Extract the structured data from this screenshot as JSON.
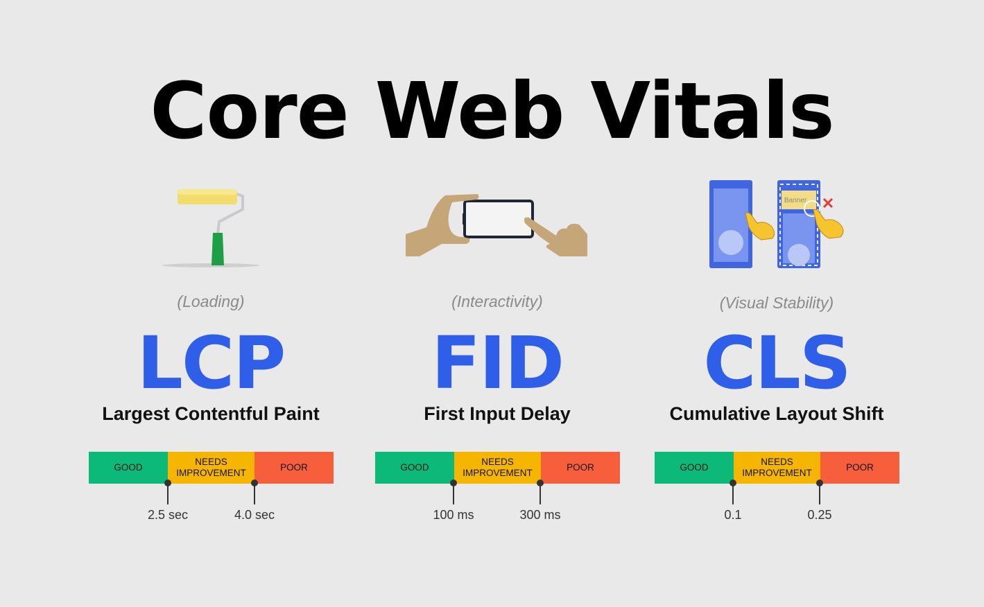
{
  "title": "Core Web Vitals",
  "colors": {
    "background": "#e9e9e9",
    "acronym": "#2f5fe8",
    "good": "#0cb978",
    "needs_improvement": "#f6b500",
    "poor": "#f75e3c"
  },
  "metrics": [
    {
      "category": "(Loading)",
      "acronym": "LCP",
      "full_name": "Largest Contentful Paint",
      "illustration": "paint-roller-icon",
      "bands": [
        "GOOD",
        "NEEDS IMPROVEMENT",
        "POOR"
      ],
      "thresholds": [
        "2.5 sec",
        "4.0 sec"
      ]
    },
    {
      "category": "(Interactivity)",
      "acronym": "FID",
      "full_name": "First Input Delay",
      "illustration": "hand-tapping-phone-icon",
      "bands": [
        "GOOD",
        "NEEDS IMPROVEMENT",
        "POOR"
      ],
      "thresholds": [
        "100 ms",
        "300 ms"
      ]
    },
    {
      "category": "(Visual Stability)",
      "acronym": "CLS",
      "full_name": "Cumulative Layout Shift",
      "illustration": "layout-shift-phones-icon",
      "banner_label": "Banner",
      "bands": [
        "GOOD",
        "NEEDS IMPROVEMENT",
        "POOR"
      ],
      "thresholds": [
        "0.1",
        "0.25"
      ]
    }
  ],
  "band_labels": {
    "good": "GOOD",
    "needs_line1": "NEEDS",
    "needs_line2": "IMPROVEMENT",
    "poor": "POOR"
  }
}
